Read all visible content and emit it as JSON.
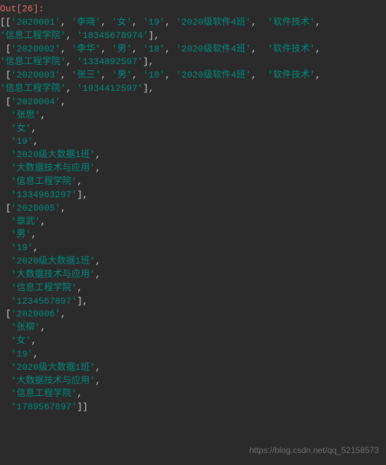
{
  "prompt": {
    "label": "Out",
    "count": "26"
  },
  "records_inline": [
    [
      "2020001",
      "李晓",
      "女",
      "19",
      "2020级软件4班",
      "软件技术",
      "信息工程学院",
      "18345678974"
    ],
    [
      "2020002",
      "李华",
      "男",
      "18",
      "2020级软件4班",
      "软件技术",
      "信息工程学院",
      "1334892597"
    ],
    [
      "2020003",
      "张三",
      "男",
      "18",
      "2020级软件4班",
      "软件技术",
      "信息工程学院",
      "1934412597"
    ]
  ],
  "records_block": [
    [
      "2020004",
      "张思",
      "女",
      "19",
      "2020级大数据1班",
      "大数据技术与应用",
      "信息工程学院",
      "1334963297"
    ],
    [
      "2020005",
      "章武",
      "男",
      "19",
      "2020级大数据1班",
      "大数据技术与应用",
      "信息工程学院",
      "1234567897"
    ],
    [
      "2020006",
      "张柳",
      "女",
      "19",
      "2020级大数据1班",
      "大数据技术与应用",
      "信息工程学院",
      "1789567897"
    ]
  ],
  "watermark": "https://blog.csdn.net/qq_52158573"
}
